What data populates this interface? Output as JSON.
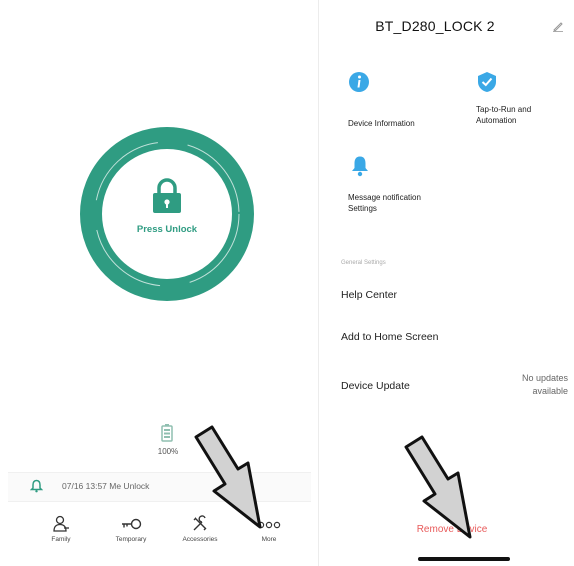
{
  "left": {
    "lock_button_label": "Press Unlock",
    "battery_percent_text": "100%",
    "log_entry": "07/16 13:57 Me Unlock",
    "tabs": [
      {
        "label": "Family",
        "icon": "person-icon"
      },
      {
        "label": "Temporary",
        "icon": "key-icon"
      },
      {
        "label": "Accessories",
        "icon": "tools-icon"
      },
      {
        "label": "More",
        "icon": "more-dots-icon"
      }
    ]
  },
  "right": {
    "device_title": "BT_D280_LOCK 2",
    "tiles": [
      {
        "label_lines": [
          "Device Information"
        ],
        "icon": "info-icon"
      },
      {
        "label_lines": [
          "Tap-to-Run and",
          "Automation"
        ],
        "icon": "check-shield-icon"
      },
      {
        "label_lines": [
          "Message notification",
          "Settings"
        ],
        "icon": "bell-icon"
      }
    ],
    "section_header": "General Settings",
    "rows": [
      {
        "label": "Help Center"
      },
      {
        "label": "Add to Home Screen"
      },
      {
        "label": "Device Update",
        "value_lines": [
          "No updates",
          "available"
        ]
      }
    ],
    "remove_label": "Remove Device"
  },
  "colors": {
    "ring_green": "#2f9c82",
    "ring_light": "#e6f3ef",
    "info_blue": "#3aa8e6",
    "remove_red": "#e85a5a",
    "arrow_gray": "#d2d2d2"
  }
}
